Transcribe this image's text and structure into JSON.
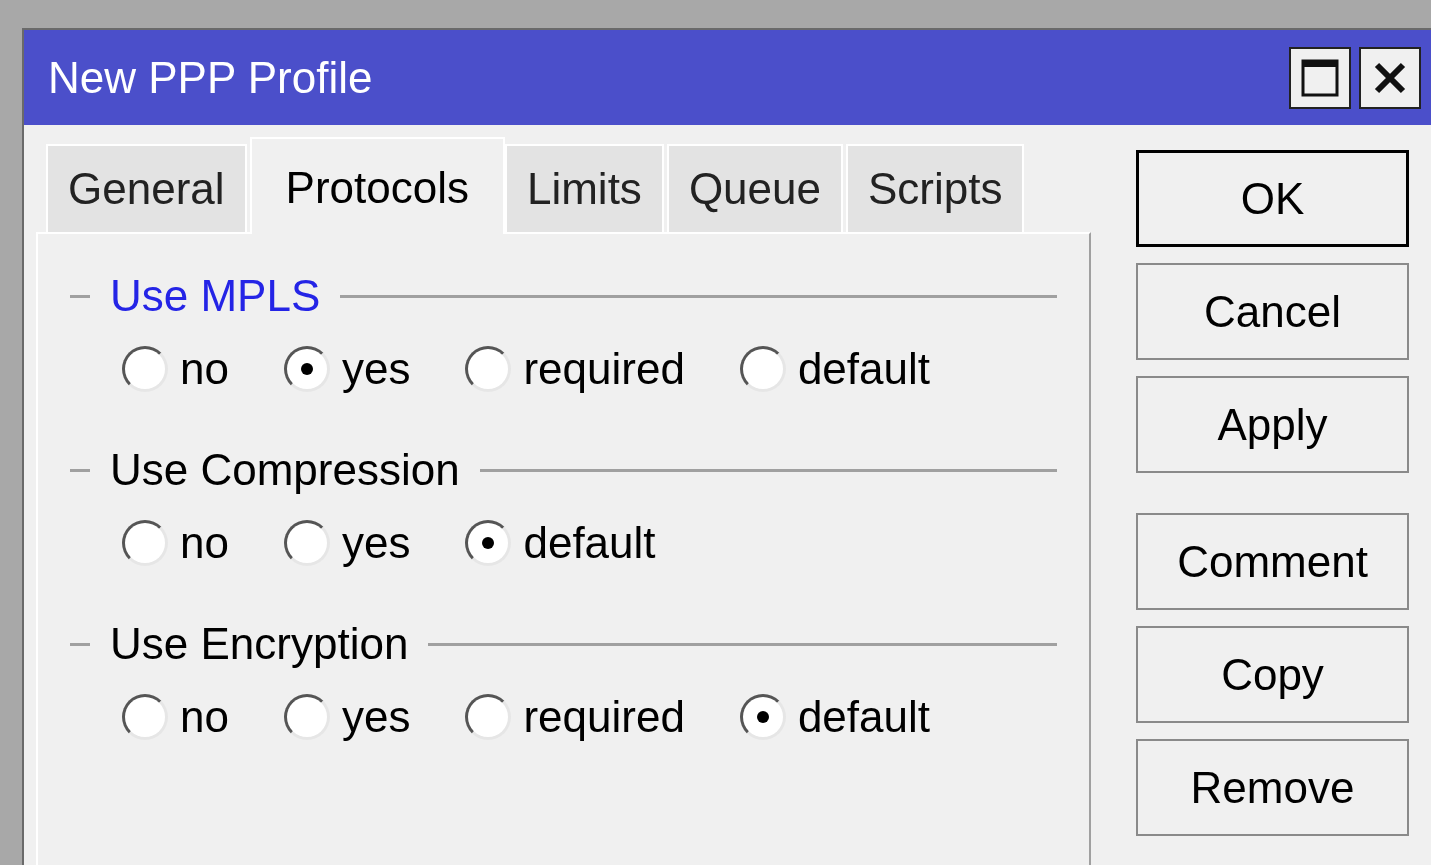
{
  "window": {
    "title": "New PPP Profile"
  },
  "tabs": [
    {
      "label": "General",
      "selected": false
    },
    {
      "label": "Protocols",
      "selected": true
    },
    {
      "label": "Limits",
      "selected": false
    },
    {
      "label": "Queue",
      "selected": false
    },
    {
      "label": "Scripts",
      "selected": false
    }
  ],
  "groups": [
    {
      "title": "Use MPLS",
      "focused": true,
      "options": [
        {
          "label": "no",
          "selected": false
        },
        {
          "label": "yes",
          "selected": true
        },
        {
          "label": "required",
          "selected": false
        },
        {
          "label": "default",
          "selected": false
        }
      ]
    },
    {
      "title": "Use Compression",
      "focused": false,
      "options": [
        {
          "label": "no",
          "selected": false
        },
        {
          "label": "yes",
          "selected": false
        },
        {
          "label": "default",
          "selected": true
        }
      ]
    },
    {
      "title": "Use Encryption",
      "focused": false,
      "options": [
        {
          "label": "no",
          "selected": false
        },
        {
          "label": "yes",
          "selected": false
        },
        {
          "label": "required",
          "selected": false
        },
        {
          "label": "default",
          "selected": true
        }
      ]
    }
  ],
  "button_groups": [
    [
      {
        "label": "OK",
        "default": true
      },
      {
        "label": "Cancel",
        "default": false
      },
      {
        "label": "Apply",
        "default": false
      }
    ],
    [
      {
        "label": "Comment",
        "default": false
      },
      {
        "label": "Copy",
        "default": false
      },
      {
        "label": "Remove",
        "default": false
      }
    ]
  ]
}
